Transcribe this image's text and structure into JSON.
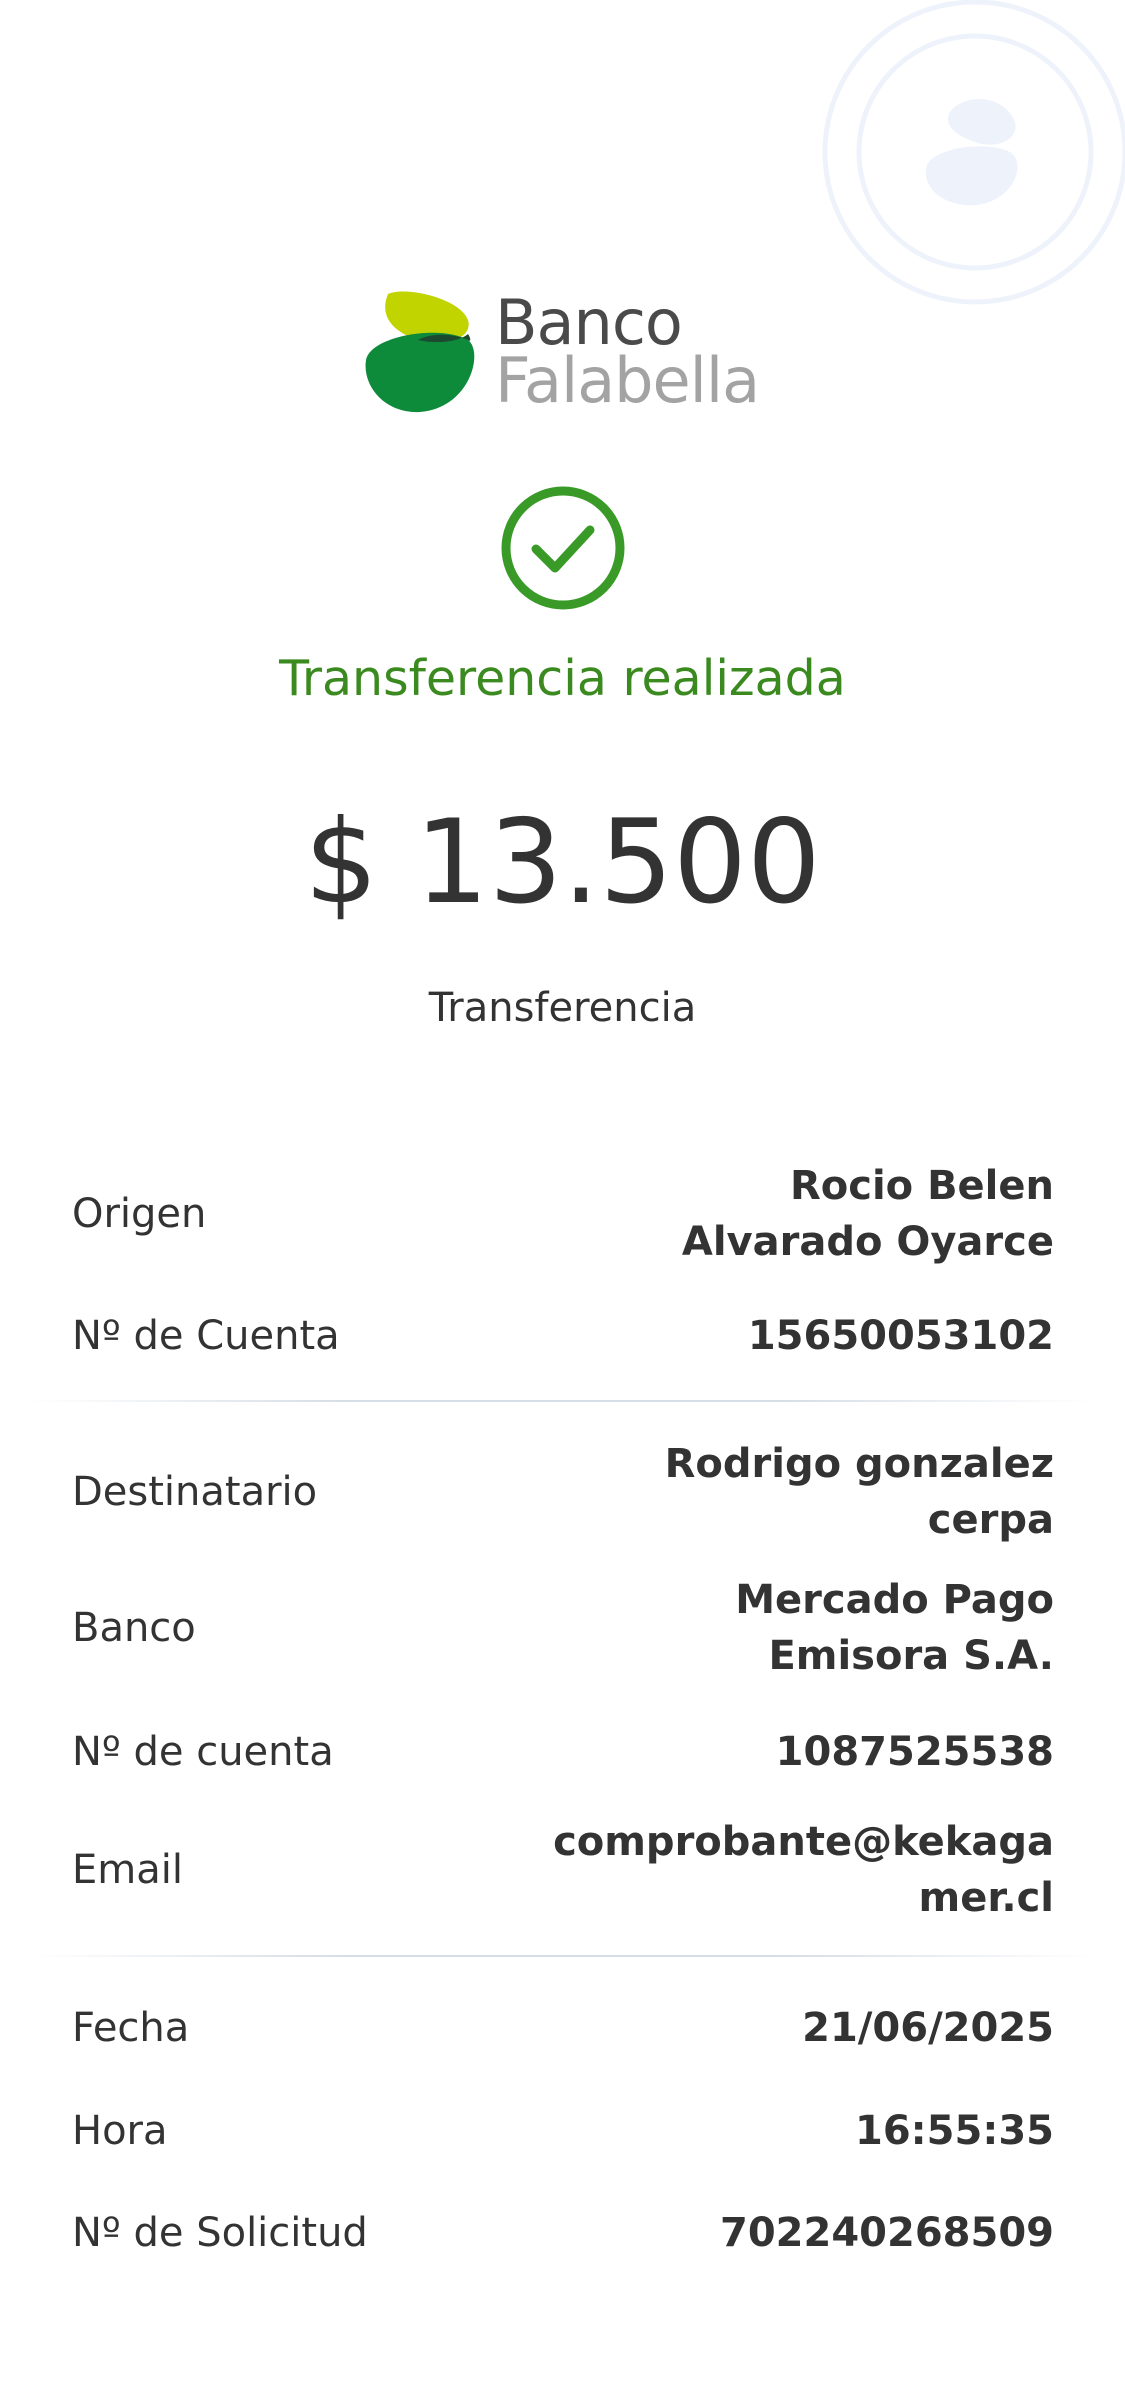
{
  "brand": {
    "line1": "Banco",
    "line2": "Falabella",
    "colors": {
      "lime": "#c2d400",
      "green": "#0d8a3a",
      "dark_overlap": "#1b4a2f"
    }
  },
  "status": {
    "icon": "check-circle-icon",
    "text": "Transferencia realizada",
    "color": "#3a8a1f"
  },
  "amount": "$ 13.500",
  "transfer_type": "Transferencia",
  "origin": [
    {
      "label": "Origen",
      "value_lines": [
        "Rocio Belen",
        "Alvarado Oyarce"
      ]
    },
    {
      "label": "Nº de Cuenta",
      "value_lines": [
        "15650053102"
      ]
    }
  ],
  "destination": [
    {
      "label": "Destinatario",
      "value_lines": [
        "Rodrigo gonzalez",
        "cerpa"
      ]
    },
    {
      "label": "Banco",
      "value_lines": [
        "Mercado Pago",
        "Emisora S.A."
      ]
    },
    {
      "label": "Nº de cuenta",
      "value_lines": [
        "1087525538"
      ]
    },
    {
      "label": "Email",
      "value_lines": [
        "comprobante@kekaga",
        "mer.cl"
      ]
    }
  ],
  "details": [
    {
      "label": "Fecha",
      "value_lines": [
        "21/06/2025"
      ]
    },
    {
      "label": "Hora",
      "value_lines": [
        "16:55:35"
      ]
    },
    {
      "label": "Nº de Solicitud",
      "value_lines": [
        "702240268509"
      ]
    }
  ]
}
